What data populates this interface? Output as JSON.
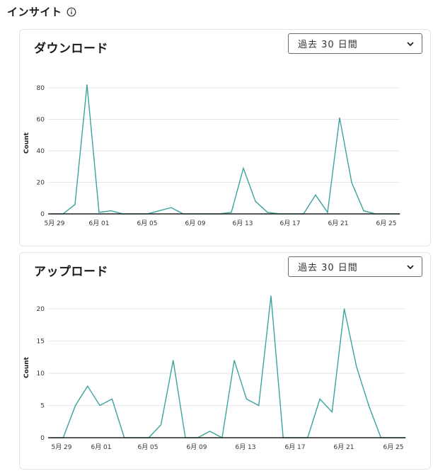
{
  "header": {
    "title": "インサイト",
    "info_icon": "info-circle-icon"
  },
  "colors": {
    "line": "#3aa39d",
    "baseline": "#222222",
    "grid": "#e6e6e6"
  },
  "cards": [
    {
      "id": "card1",
      "title": "ダウンロード",
      "range_select": {
        "value": "過去 30 日間",
        "icon": "chevron-down-icon"
      }
    },
    {
      "id": "card2",
      "title": "アップロード",
      "range_select": {
        "value": "過去 30 日間",
        "icon": "chevron-down-icon"
      }
    }
  ],
  "chart_data": [
    {
      "type": "line",
      "title": "",
      "xlabel": "",
      "ylabel": "Count",
      "ylim": [
        0,
        90
      ],
      "yticks": [
        0,
        20,
        40,
        60,
        80
      ],
      "grid": true,
      "x_tick_labels": [
        "5月 29",
        "6月 01",
        "6月 05",
        "6月 09",
        "6月 13",
        "6月 17",
        "6月 21",
        "6月 25"
      ],
      "x": [
        "5/28",
        "5/29",
        "5/30",
        "5/31",
        "6/01",
        "6/02",
        "6/03",
        "6/04",
        "6/05",
        "6/06",
        "6/07",
        "6/08",
        "6/09",
        "6/10",
        "6/11",
        "6/12",
        "6/13",
        "6/14",
        "6/15",
        "6/16",
        "6/17",
        "6/18",
        "6/19",
        "6/20",
        "6/21",
        "6/22",
        "6/23",
        "6/24",
        "6/25",
        "6/26"
      ],
      "values": [
        0,
        0,
        6,
        82,
        1,
        2,
        0,
        0,
        0,
        2,
        4,
        0,
        0,
        0,
        0,
        1,
        29,
        8,
        1,
        0,
        0,
        0,
        12,
        1,
        61,
        20,
        2,
        0,
        0,
        0
      ]
    },
    {
      "type": "line",
      "title": "",
      "xlabel": "",
      "ylabel": "Count",
      "ylim": [
        0,
        24
      ],
      "yticks": [
        0,
        5,
        10,
        15,
        20
      ],
      "grid": true,
      "x_tick_labels": [
        "5月 29",
        "6月 01",
        "6月 05",
        "6月 09",
        "6月 13",
        "6月 17",
        "6月 21",
        "6月 25"
      ],
      "x": [
        "5/28",
        "5/29",
        "5/30",
        "5/31",
        "6/01",
        "6/02",
        "6/03",
        "6/04",
        "6/05",
        "6/06",
        "6/07",
        "6/08",
        "6/09",
        "6/10",
        "6/11",
        "6/12",
        "6/13",
        "6/14",
        "6/15",
        "6/16",
        "6/17",
        "6/18",
        "6/19",
        "6/20",
        "6/21",
        "6/22",
        "6/23",
        "6/24",
        "6/25",
        "6/26"
      ],
      "values": [
        0,
        0,
        5,
        8,
        5,
        6,
        0,
        0,
        0,
        2,
        12,
        0,
        0,
        1,
        0,
        12,
        6,
        5,
        22,
        0,
        0,
        0,
        6,
        4,
        20,
        11,
        5,
        0,
        0,
        0
      ]
    }
  ]
}
